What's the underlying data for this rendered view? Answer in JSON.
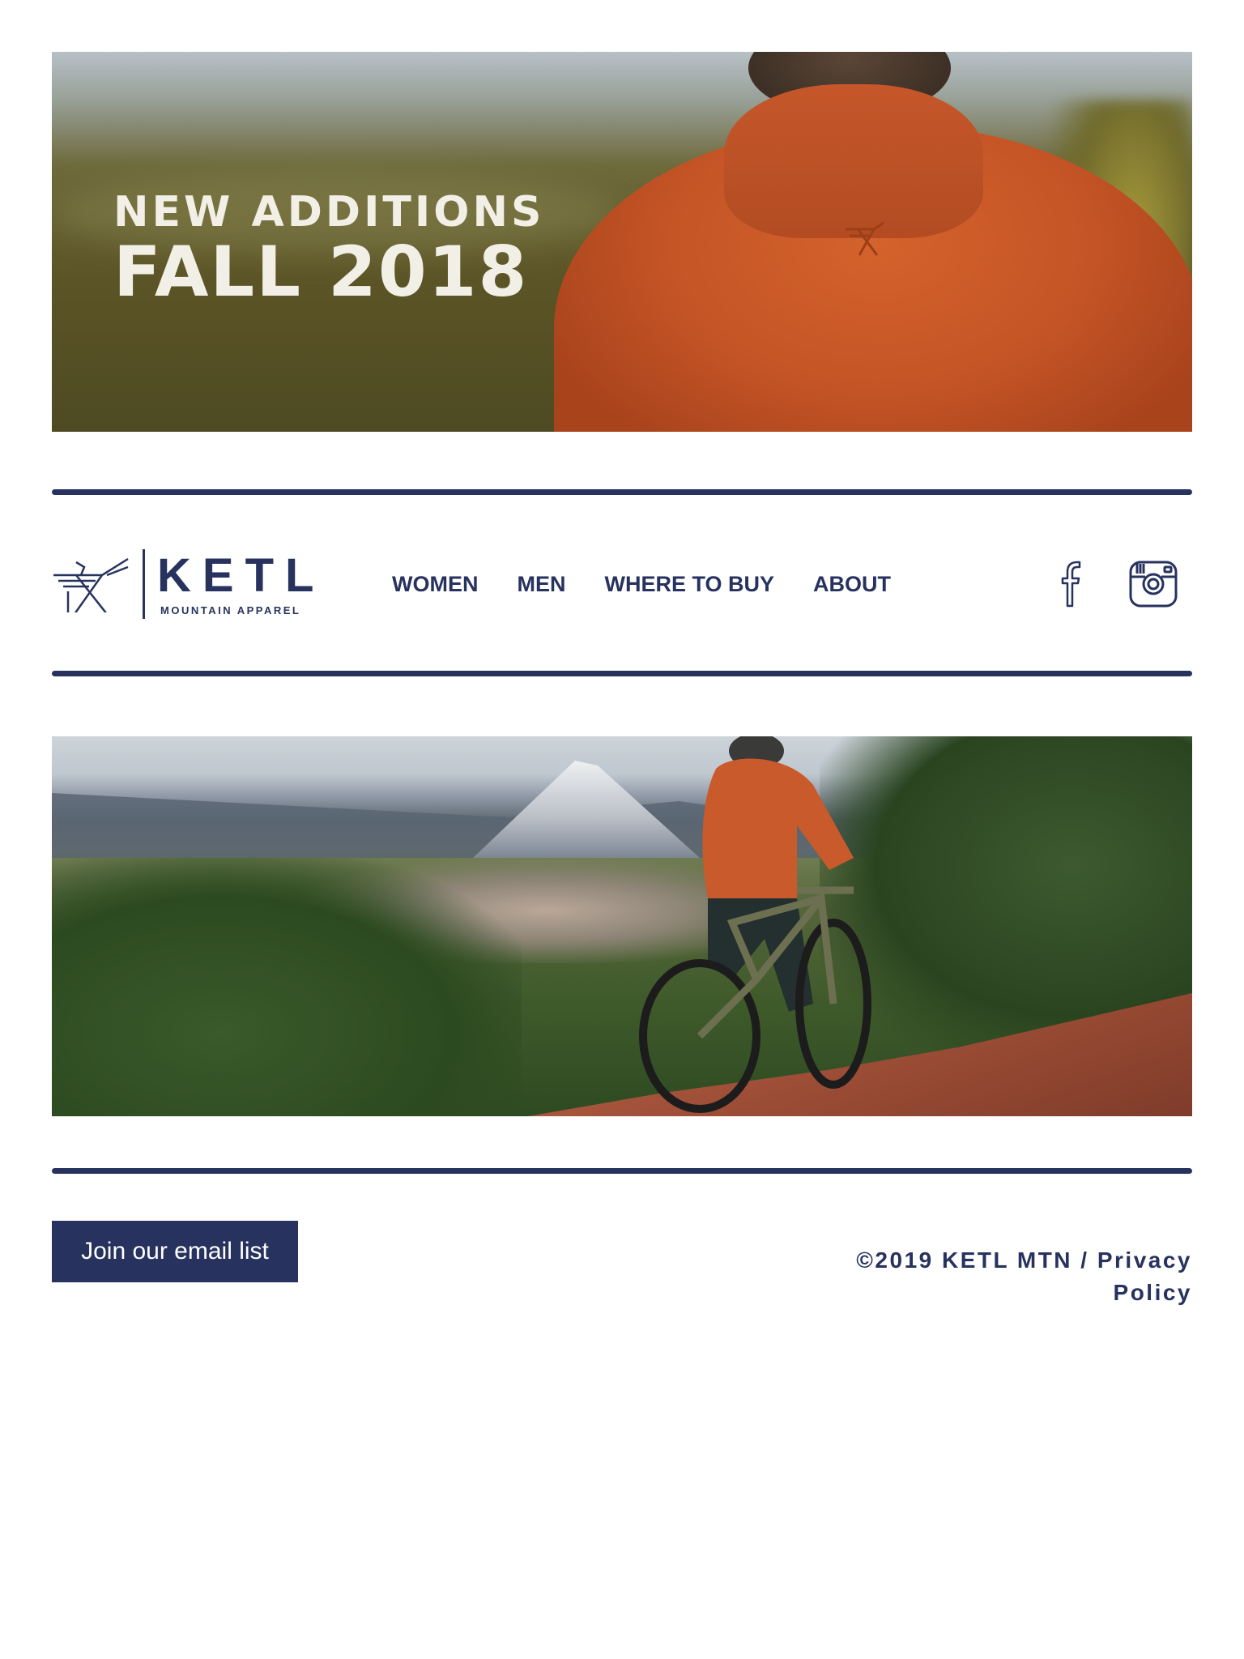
{
  "hero": {
    "line1": "NEW ADDITIONS",
    "line2": "FALL 2018"
  },
  "brand": {
    "name": "KETL",
    "tagline": "MOUNTAIN APPAREL",
    "color": "#27325e"
  },
  "nav": {
    "items": [
      {
        "label": "WOMEN"
      },
      {
        "label": "MEN"
      },
      {
        "label": "WHERE TO BUY"
      },
      {
        "label": "ABOUT"
      }
    ]
  },
  "social": {
    "icons": [
      "facebook-icon",
      "instagram-icon"
    ]
  },
  "cta": {
    "label": "Join our email list"
  },
  "footer": {
    "copyright": "©2019 KETL MTN / ",
    "privacy_label": "Privacy Policy"
  }
}
